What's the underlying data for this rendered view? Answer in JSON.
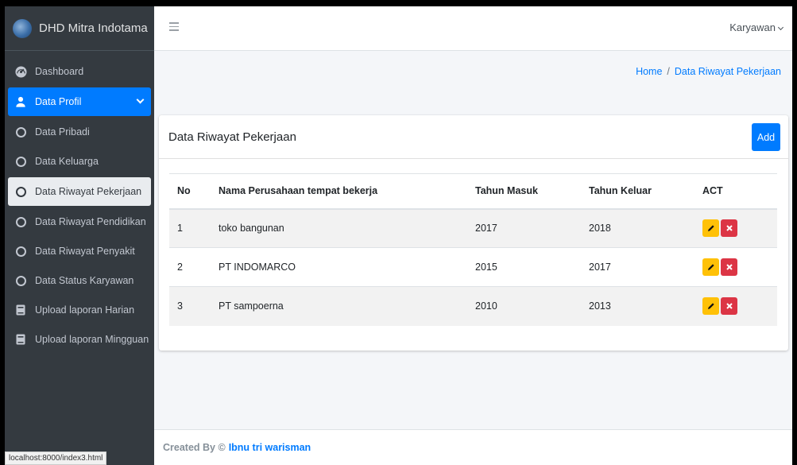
{
  "brand": {
    "name": "DHD Mitra Indotama"
  },
  "sidebar": {
    "items": [
      {
        "label": "Dashboard",
        "icon": "dashboard-icon"
      },
      {
        "label": "Data Profil",
        "icon": "user-icon"
      },
      {
        "label": "Data Pribadi",
        "icon": "circle-icon"
      },
      {
        "label": "Data Keluarga",
        "icon": "circle-icon"
      },
      {
        "label": "Data Riwayat Pekerjaan",
        "icon": "circle-icon"
      },
      {
        "label": "Data Riwayat Pendidikan",
        "icon": "circle-icon"
      },
      {
        "label": "Data Riwayat Penyakit",
        "icon": "circle-icon"
      },
      {
        "label": "Data Status Karyawan",
        "icon": "circle-icon"
      },
      {
        "label": "Upload laporan Harian",
        "icon": "book-icon"
      },
      {
        "label": "Upload laporan Mingguan",
        "icon": "book-icon"
      }
    ]
  },
  "topbar": {
    "user": "Karyawan"
  },
  "breadcrumb": {
    "home": "Home",
    "separator": "/",
    "current": "Data Riwayat Pekerjaan"
  },
  "card": {
    "title": "Data Riwayat Pekerjaan",
    "add_label": "Add",
    "columns": [
      "No",
      "Nama Perusahaan tempat bekerja",
      "Tahun Masuk",
      "Tahun Keluar",
      "ACT"
    ],
    "rows": [
      {
        "no": "1",
        "company": "toko bangunan",
        "masuk": "2017",
        "keluar": "2018"
      },
      {
        "no": "2",
        "company": "PT INDOMARCO",
        "masuk": "2015",
        "keluar": "2017"
      },
      {
        "no": "3",
        "company": "PT sampoerna",
        "masuk": "2010",
        "keluar": "2013"
      }
    ]
  },
  "footer": {
    "prefix": "Created By ©",
    "author": "Ibnu tri warisman"
  },
  "status_bar": {
    "url": "localhost:8000/index3.html"
  },
  "colors": {
    "primary": "#007bff",
    "sidebar": "#343a40",
    "warning": "#ffc107",
    "danger": "#dc3545"
  }
}
